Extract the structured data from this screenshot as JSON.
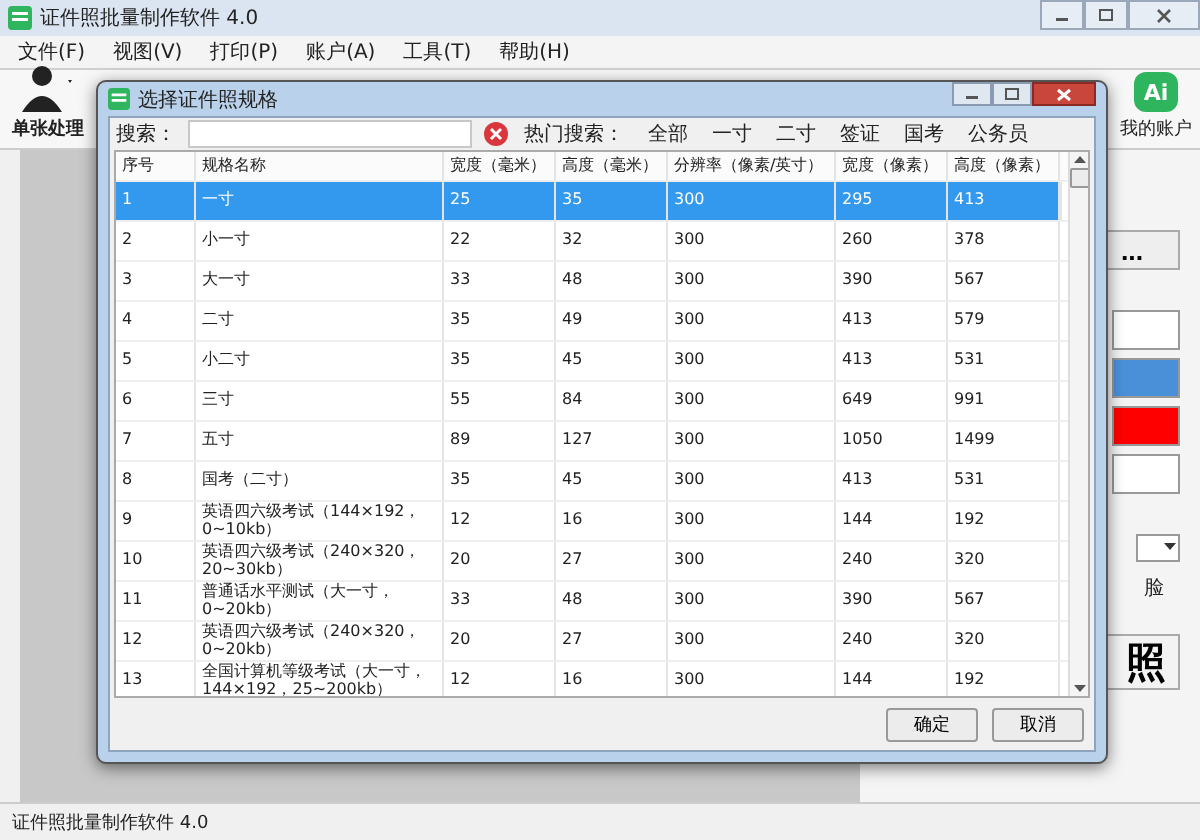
{
  "window": {
    "title": "证件照批量制作软件 4.0"
  },
  "menu": [
    "文件(F)",
    "视图(V)",
    "打印(P)",
    "账户(A)",
    "工具(T)",
    "帮助(H)"
  ],
  "toolbar": {
    "left_label": "单张处理",
    "right_label": "我的账户",
    "logo_text": "Ai"
  },
  "side_panel": {
    "more_button": "...",
    "color_swatches": [
      {
        "color": "#ffffff"
      },
      {
        "color": "#4a90d9"
      },
      {
        "color": "#ff0000"
      },
      {
        "color": "#ffffff"
      }
    ],
    "option_fragment": "脸",
    "big_button": "照"
  },
  "dialog": {
    "title": "选择证件照规格",
    "search_label": "搜索：",
    "hot_label": "热门搜索：",
    "hot_tags": [
      "全部",
      "一寸",
      "二寸",
      "签证",
      "国考",
      "公务员"
    ],
    "columns": [
      "序号",
      "规格名称",
      "宽度（毫米）",
      "高度（毫米）",
      "分辨率（像素/英寸）",
      "宽度（像素）",
      "高度（像素）"
    ],
    "rows": [
      {
        "cells": [
          "1",
          "一寸",
          "25",
          "35",
          "300",
          "295",
          "413"
        ],
        "selected": true
      },
      {
        "cells": [
          "2",
          "小一寸",
          "22",
          "32",
          "300",
          "260",
          "378"
        ],
        "selected": false
      },
      {
        "cells": [
          "3",
          "大一寸",
          "33",
          "48",
          "300",
          "390",
          "567"
        ],
        "selected": false
      },
      {
        "cells": [
          "4",
          "二寸",
          "35",
          "49",
          "300",
          "413",
          "579"
        ],
        "selected": false
      },
      {
        "cells": [
          "5",
          "小二寸",
          "35",
          "45",
          "300",
          "413",
          "531"
        ],
        "selected": false
      },
      {
        "cells": [
          "6",
          "三寸",
          "55",
          "84",
          "300",
          "649",
          "991"
        ],
        "selected": false
      },
      {
        "cells": [
          "7",
          "五寸",
          "89",
          "127",
          "300",
          "1050",
          "1499"
        ],
        "selected": false
      },
      {
        "cells": [
          "8",
          "国考（二寸）",
          "35",
          "45",
          "300",
          "413",
          "531"
        ],
        "selected": false
      },
      {
        "cells": [
          "9",
          "英语四六级考试（144×192，0~10kb）",
          "12",
          "16",
          "300",
          "144",
          "192"
        ],
        "selected": false
      },
      {
        "cells": [
          "10",
          "英语四六级考试（240×320，20~30kb）",
          "20",
          "27",
          "300",
          "240",
          "320"
        ],
        "selected": false
      },
      {
        "cells": [
          "11",
          "普通话水平测试（大一寸，0~20kb）",
          "33",
          "48",
          "300",
          "390",
          "567"
        ],
        "selected": false
      },
      {
        "cells": [
          "12",
          "英语四六级考试（240×320，0~20kb）",
          "20",
          "27",
          "300",
          "240",
          "320"
        ],
        "selected": false
      },
      {
        "cells": [
          "13",
          "全国计算机等级考试（大一寸，144×192，25~200kb）",
          "12",
          "16",
          "300",
          "144",
          "192"
        ],
        "selected": false
      }
    ],
    "buttons": [
      "确定",
      "取消"
    ]
  },
  "status_bar": "证件照批量制作软件 4.0"
}
